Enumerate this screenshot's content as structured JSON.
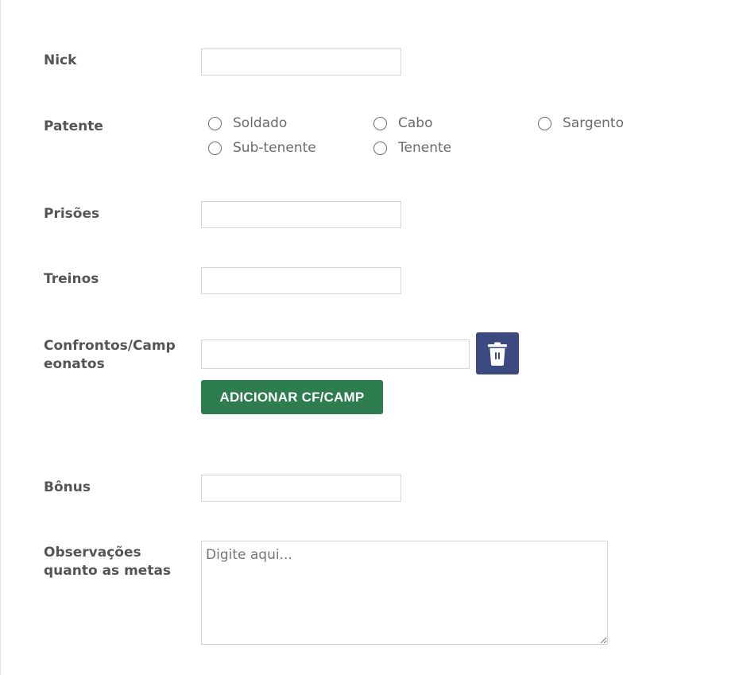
{
  "form": {
    "nick": {
      "label": "Nick",
      "value": ""
    },
    "patente": {
      "label": "Patente",
      "options": [
        "Soldado",
        "Cabo",
        "Sargento",
        "Sub-tenente",
        "Tenente"
      ],
      "selected": null
    },
    "prisoes": {
      "label": "Prisões",
      "value": ""
    },
    "treinos": {
      "label": "Treinos",
      "value": ""
    },
    "confrontos": {
      "label": "Confrontos/Camp\neonatos",
      "value": "",
      "delete_icon": "trash-icon",
      "add_button_label": "ADICIONAR CF/CAMP"
    },
    "bonus": {
      "label": "Bônus",
      "value": ""
    },
    "observacoes": {
      "label": "Observações\nquanto as metas",
      "placeholder": "Digite aqui..."
    }
  },
  "colors": {
    "label_text": "#555555",
    "delete_button": "#3d4a80",
    "add_button": "#2e7d4f",
    "input_border": "#d6d6d6"
  }
}
